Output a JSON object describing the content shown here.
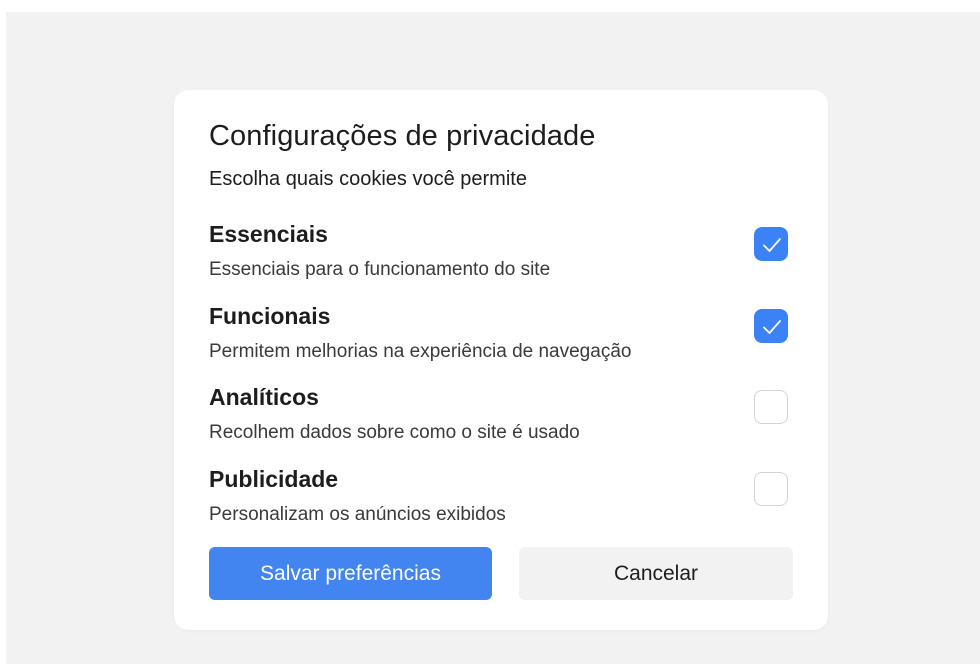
{
  "dialog": {
    "title": "Configurações de privacidade",
    "subtitle": "Escolha quais cookies você permite",
    "options": [
      {
        "title": "Essenciais",
        "description": "Essenciais para o funcionamento do site",
        "checked": true
      },
      {
        "title": "Funcionais",
        "description": "Permitem melhorias na experiência de navegação",
        "checked": true
      },
      {
        "title": "Analíticos",
        "description": "Recolhem dados sobre como o site é usado",
        "checked": false
      },
      {
        "title": "Publicidade",
        "description": "Personalizam os anúncios exibidos",
        "checked": false
      }
    ],
    "buttons": {
      "save_label": "Salvar preferências",
      "cancel_label": "Cancelar"
    }
  },
  "colors": {
    "accent": "#4385f0",
    "checkbox_checked": "#3b82f6",
    "background": "#f2f2f2",
    "dialog": "#ffffff"
  },
  "icons": {
    "check": "checkmark-icon"
  }
}
